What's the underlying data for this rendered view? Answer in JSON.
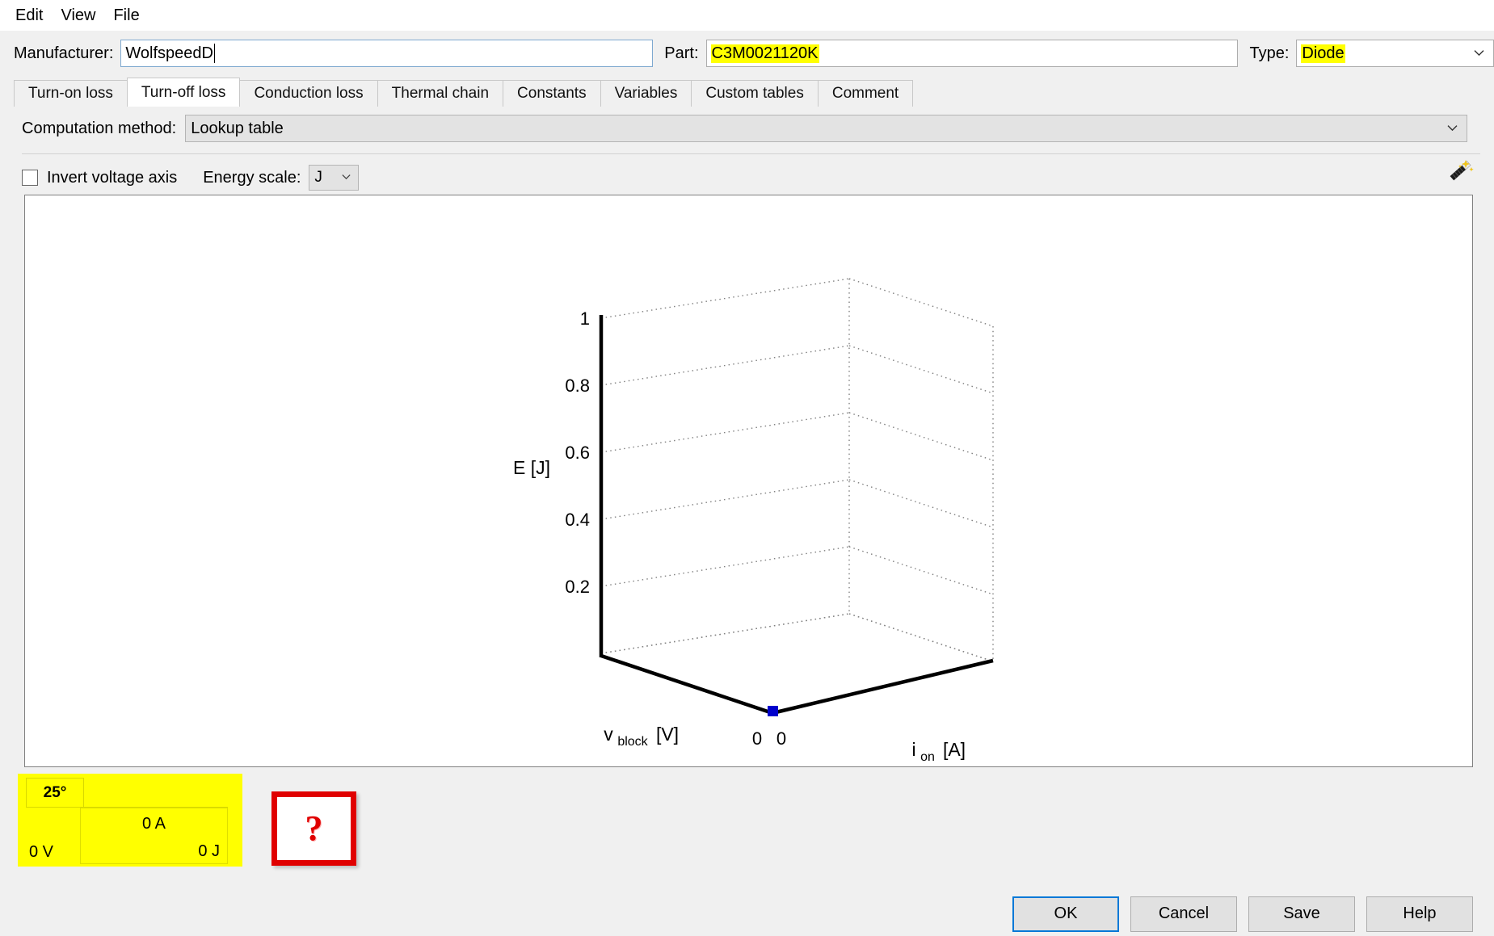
{
  "menu": {
    "items": [
      {
        "label": "Edit"
      },
      {
        "label": "View"
      },
      {
        "label": "File"
      }
    ]
  },
  "header": {
    "manufacturer_label": "Manufacturer:",
    "manufacturer_value": "WolfspeedD",
    "part_label": "Part:",
    "part_value": "C3M0021120K",
    "type_label": "Type:",
    "type_value": "Diode",
    "highlight_color": "#ffff00"
  },
  "tabs": [
    {
      "label": "Turn-on loss",
      "active": false
    },
    {
      "label": "Turn-off loss",
      "active": true
    },
    {
      "label": "Conduction loss",
      "active": false
    },
    {
      "label": "Thermal chain",
      "active": false
    },
    {
      "label": "Constants",
      "active": false
    },
    {
      "label": "Variables",
      "active": false
    },
    {
      "label": "Custom tables",
      "active": false
    },
    {
      "label": "Comment",
      "active": false
    }
  ],
  "computation": {
    "label": "Computation method:",
    "value": "Lookup table"
  },
  "options": {
    "invert_axis_label": "Invert voltage axis",
    "invert_axis_checked": false,
    "energy_scale_label": "Energy scale:",
    "energy_scale_value": "J",
    "wand_icon": "magic-wand-icon"
  },
  "chart_data": {
    "type": "scatter",
    "title": "",
    "is3d": true,
    "xlabel": "v_block [V]",
    "xlabel_base": "v",
    "xlabel_sub": "block",
    "xlabel_unit": "[V]",
    "ylabel": "i_on [A]",
    "ylabel_base": "i",
    "ylabel_sub": "on",
    "ylabel_unit": "[A]",
    "zlabel": "E [J]",
    "zticks": [
      "0.2",
      "0.4",
      "0.6",
      "0.8",
      "1"
    ],
    "zvalues": [
      0.2,
      0.4,
      0.6,
      0.8,
      1
    ],
    "zlim": [
      0,
      1
    ],
    "xticks": [
      "0"
    ],
    "yticks": [
      "0"
    ],
    "xlim": [
      0,
      0
    ],
    "ylim": [
      0,
      0
    ],
    "grid": true,
    "legend": false,
    "points": [
      {
        "x": 0,
        "y": 0,
        "z": 0,
        "color": "#0000cc"
      }
    ],
    "series": [
      {
        "name": "E",
        "values": [
          0
        ]
      }
    ]
  },
  "table": {
    "temperature_tab": "25°",
    "column_header": "0 A",
    "row_header": "0 V",
    "cell_value": "0 J",
    "highlight_color": "#ffff00"
  },
  "annotation": {
    "question_mark": "?",
    "border_color": "#e00000"
  },
  "buttons": [
    {
      "label": "OK",
      "primary": true
    },
    {
      "label": "Cancel",
      "primary": false
    },
    {
      "label": "Save",
      "primary": false
    },
    {
      "label": "Help",
      "primary": false
    }
  ]
}
